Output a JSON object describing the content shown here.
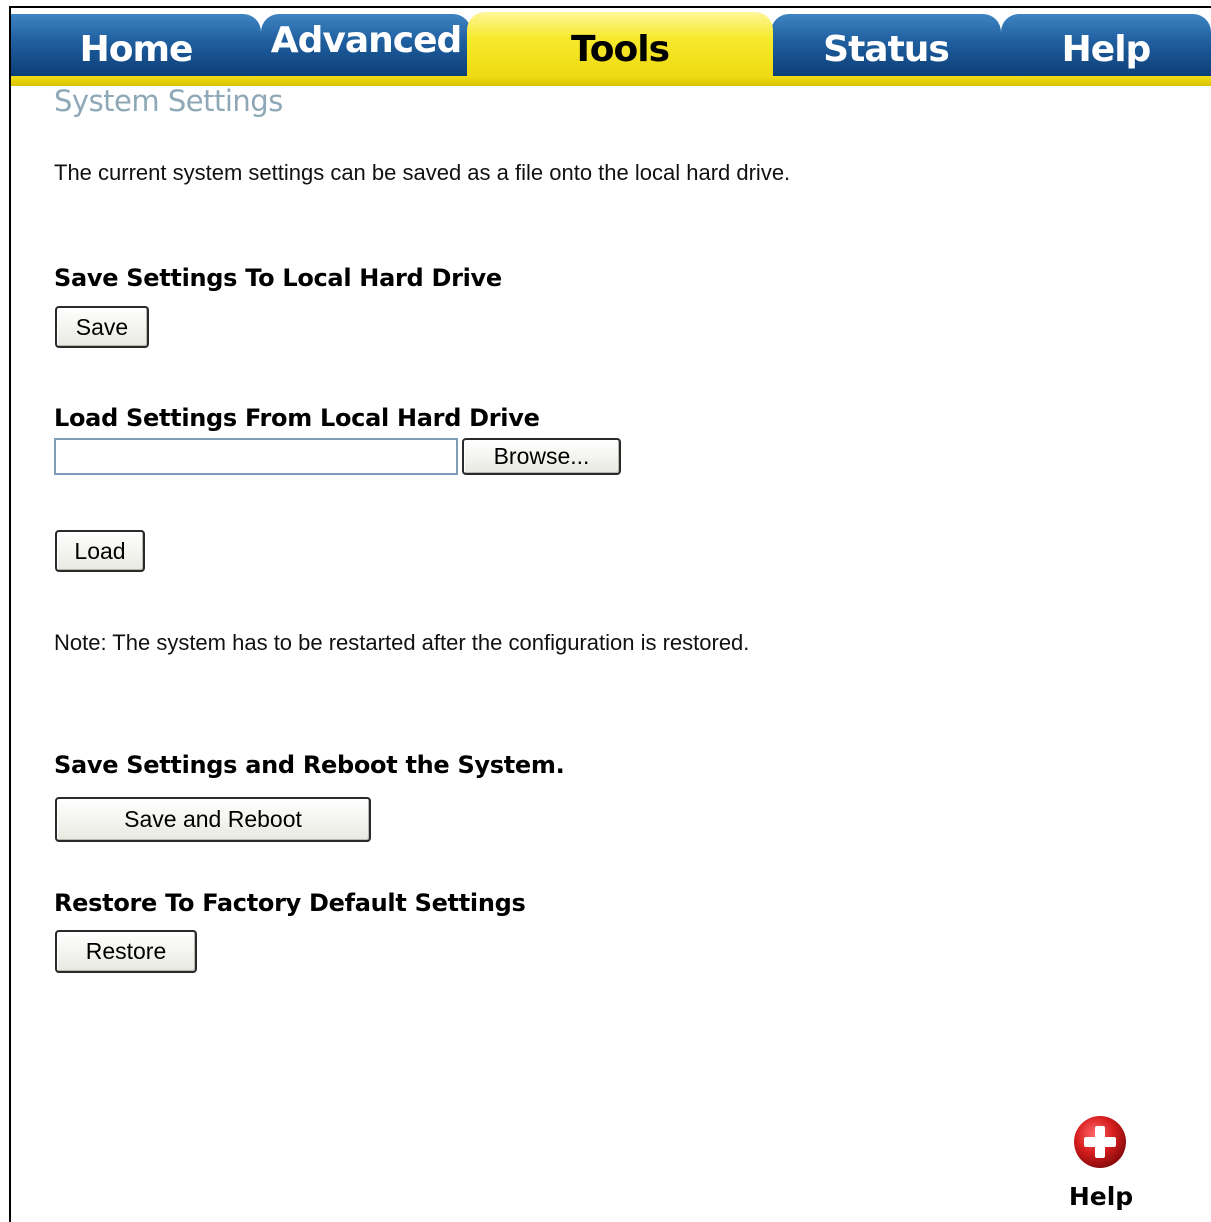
{
  "nav": {
    "tabs": [
      {
        "label": "Home"
      },
      {
        "label": "Advanced"
      },
      {
        "label": "Tools"
      },
      {
        "label": "Status"
      },
      {
        "label": "Help"
      }
    ],
    "active": "Tools"
  },
  "page": {
    "title": "System Settings",
    "intro": "The current system settings can be saved as a file onto the local hard drive."
  },
  "save_section": {
    "heading": "Save Settings To Local Hard Drive",
    "button": "Save"
  },
  "load_section": {
    "heading": "Load Settings From Local Hard Drive",
    "file_value": "",
    "browse_button": "Browse...",
    "load_button": "Load",
    "note": "Note: The system has to be restarted after the configuration is restored."
  },
  "reboot_section": {
    "heading": "Save Settings and Reboot the System.",
    "button": "Save and Reboot"
  },
  "restore_section": {
    "heading": "Restore To Factory Default Settings",
    "button": "Restore"
  },
  "help_link": {
    "label": "Help",
    "icon": "help-plus-icon"
  },
  "colors": {
    "tab_blue": "#1f5e9e",
    "tab_active_yellow": "#f7e92c",
    "title_gray_blue": "#8fa8b8",
    "help_icon_red": "#d81e1e"
  }
}
